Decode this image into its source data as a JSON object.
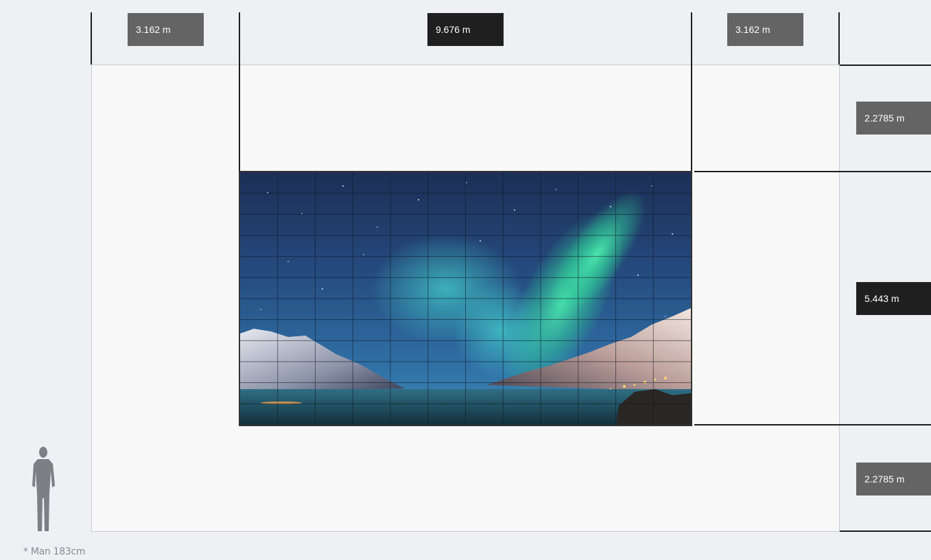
{
  "dimensions": {
    "left_margin": "3.162 m",
    "screen_width": "9.676 m",
    "right_margin": "3.162 m",
    "top_margin": "2.2785 m",
    "screen_height": "5.443 m",
    "bottom_margin": "2.2785 m"
  },
  "scale_reference": {
    "caption": "* Man 183cm",
    "icon": "standing-man-icon"
  },
  "screen": {
    "image": "aurora-borealis-fjord-photo",
    "grid_columns": 12,
    "grid_rows": 12
  },
  "colors": {
    "background": "#eef0f4",
    "wall": "#f8f8f8",
    "label_grey": "#646464",
    "label_dark": "#1f1f1f",
    "lines": "#1d1d1d"
  }
}
